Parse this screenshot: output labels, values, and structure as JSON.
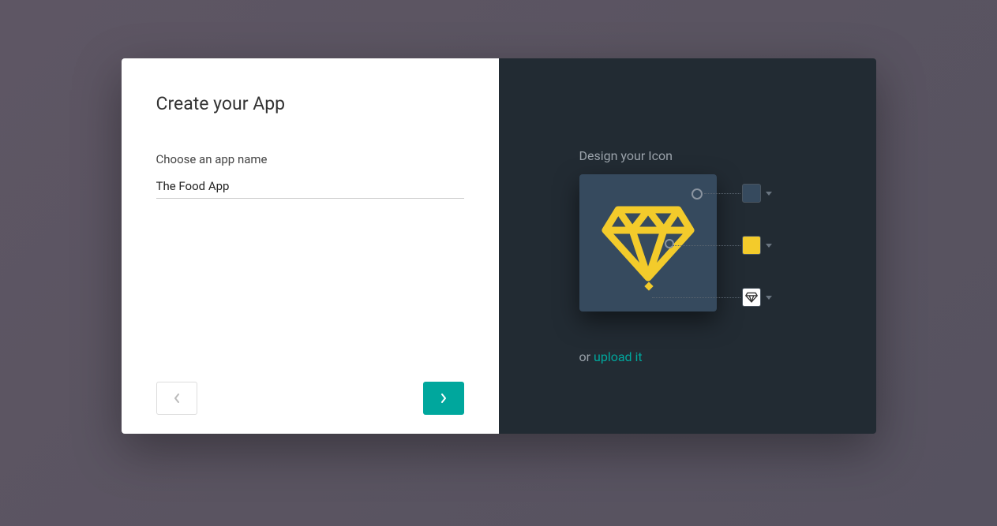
{
  "left": {
    "title": "Create your App",
    "field_label": "Choose an app name",
    "app_name_value": "The Food App"
  },
  "right": {
    "title": "Design your Icon",
    "upload_prefix": "or ",
    "upload_link": "upload it",
    "colors": {
      "background": "#364a5e",
      "foreground": "#f3cb2b"
    },
    "icon_shape": "diamond"
  }
}
